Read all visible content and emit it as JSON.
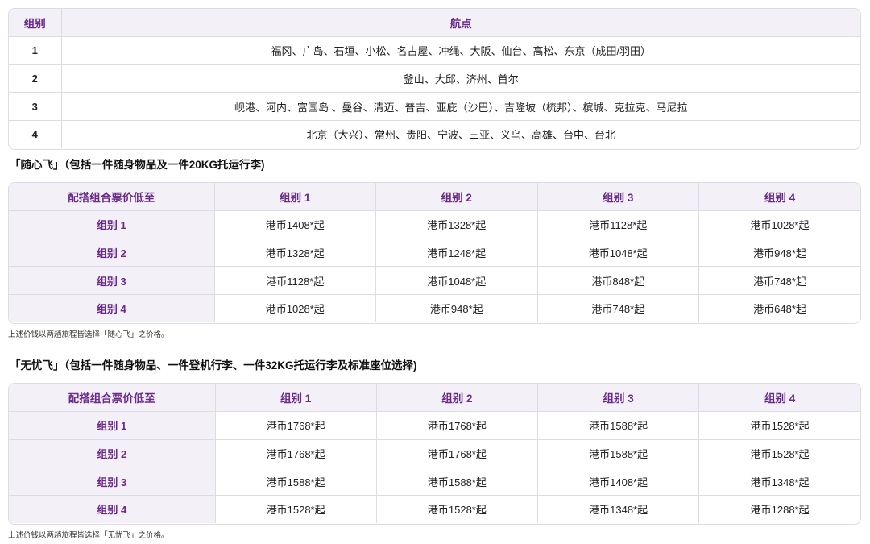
{
  "destinations": {
    "headers": [
      "组别",
      "航点"
    ],
    "rows": [
      {
        "group": "1",
        "points": "福冈、广岛、石垣、小松、名古屋、冲绳、大阪、仙台、高松、东京（成田/羽田）"
      },
      {
        "group": "2",
        "points": "釜山、大邱、济州、首尔"
      },
      {
        "group": "3",
        "points": "岘港、河内、富国岛 、曼谷、清迈、普吉、亚庇（沙巴）、吉隆坡（梳邦）、槟城、克拉克、马尼拉"
      },
      {
        "group": "4",
        "points": "北京（大兴）、常州、贵阳、宁波、三亚、义乌、高雄、台中、台北"
      }
    ]
  },
  "fare1": {
    "heading": "「随心飞」（包括一件随身物品及一件20KG托运行李)",
    "corner": "配搭组合票价低至",
    "cols": [
      "组别 1",
      "组别 2",
      "组别 3",
      "组别 4"
    ],
    "rows": [
      {
        "label": "组别 1",
        "cells": [
          "港币1408*起",
          "港币1328*起",
          "港币1128*起",
          "港币1028*起"
        ]
      },
      {
        "label": "组别 2",
        "cells": [
          "港币1328*起",
          "港币1248*起",
          "港币1048*起",
          "港币948*起"
        ]
      },
      {
        "label": "组别 3",
        "cells": [
          "港币1128*起",
          "港币1048*起",
          "港币848*起",
          "港币748*起"
        ]
      },
      {
        "label": "组别 4",
        "cells": [
          "港币1028*起",
          "港币948*起",
          "港币748*起",
          "港币648*起"
        ]
      }
    ],
    "note": "上述价钱以两趟旅程皆选择「随心飞」之价格。"
  },
  "fare2": {
    "heading": "「无忧飞」（包括一件随身物品、一件登机行李、一件32KG托运行李及标准座位选择)",
    "corner": "配搭组合票价低至",
    "cols": [
      "组别 1",
      "组别 2",
      "组别 3",
      "组别 4"
    ],
    "rows": [
      {
        "label": "组别 1",
        "cells": [
          "港币1768*起",
          "港币1768*起",
          "港币1588*起",
          "港币1528*起"
        ]
      },
      {
        "label": "组别 2",
        "cells": [
          "港币1768*起",
          "港币1768*起",
          "港币1588*起",
          "港币1528*起"
        ]
      },
      {
        "label": "组别 3",
        "cells": [
          "港币1588*起",
          "港币1588*起",
          "港币1408*起",
          "港币1348*起"
        ]
      },
      {
        "label": "组别 4",
        "cells": [
          "港币1528*起",
          "港币1528*起",
          "港币1348*起",
          "港币1288*起"
        ]
      }
    ],
    "note": "上述价钱以两趟旅程皆选择「无忧飞」之价格。"
  }
}
